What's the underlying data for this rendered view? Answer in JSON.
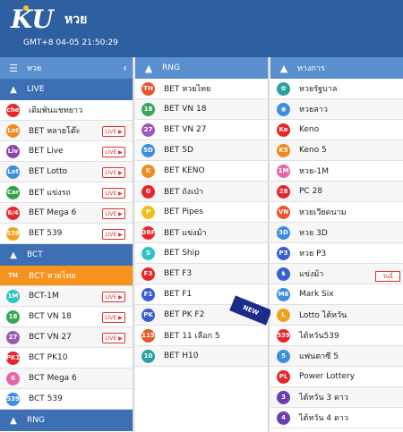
{
  "header": {
    "logo_text": "KU",
    "brand": "หวย",
    "clock": "GMT+8 04-05 21:50:29"
  },
  "left": {
    "top_label": "หวย",
    "sections": [
      {
        "title": "LIVE",
        "items": [
          {
            "label": "เดิมพันแชทยาว",
            "icon": "check",
            "color": "#e8252a",
            "live": false
          },
          {
            "label": "BET หลายโต๊ะ",
            "icon": "Lottery",
            "color": "#f08a1c",
            "live": true
          },
          {
            "label": "BET Live",
            "icon": "Live",
            "color": "#8e44ad",
            "live": true
          },
          {
            "label": "BET Lotto",
            "icon": "Lotto",
            "color": "#3a8de0",
            "live": true
          },
          {
            "label": "BET แข่งรถ",
            "icon": "Car",
            "color": "#2aa148",
            "live": true
          },
          {
            "label": "BET Mega 6",
            "icon": "6/49",
            "color": "#e8252a",
            "live": true
          },
          {
            "label": "BET 539",
            "icon": "539",
            "color": "#f0a21c",
            "live": true
          }
        ]
      },
      {
        "title": "BCT",
        "items": [
          {
            "label": "BCT หวยไทย",
            "icon": "TH",
            "color": "#f7941d",
            "live": false,
            "selected": true
          },
          {
            "label": "BCT-1M",
            "icon": "1M",
            "color": "#2ec4c4",
            "live": true
          },
          {
            "label": "BCT VN 18",
            "icon": "18",
            "color": "#3ba55c",
            "live": true
          },
          {
            "label": "BCT VN 27",
            "icon": "27",
            "color": "#9b59b6",
            "live": true
          },
          {
            "label": "BCT PK10",
            "icon": "PK10",
            "color": "#e8252a",
            "live": false
          },
          {
            "label": "BCT Mega 6",
            "icon": "6",
            "color": "#e667a8",
            "live": false
          },
          {
            "label": "BCT 539",
            "icon": "539",
            "color": "#3a8de0",
            "live": false
          }
        ]
      },
      {
        "title": "RNG",
        "items": []
      }
    ]
  },
  "middle": {
    "top_label": "RNG",
    "items": [
      {
        "label": "BET หวยไทย",
        "icon": "TH",
        "color": "#e8552a"
      },
      {
        "label": "BET VN 18",
        "icon": "18",
        "color": "#3ba55c"
      },
      {
        "label": "BET VN 27",
        "icon": "27",
        "color": "#9b59b6"
      },
      {
        "label": "BET 5D",
        "icon": "5D",
        "color": "#3a8de0"
      },
      {
        "label": "BET KENO",
        "icon": "K",
        "color": "#f08a1c"
      },
      {
        "label": "BET ถังเป่า",
        "icon": "G",
        "color": "#e8252a"
      },
      {
        "label": "BET Pipes",
        "icon": "P",
        "color": "#f0c01c"
      },
      {
        "label": "BET แข่งม้า",
        "icon": "DRF",
        "color": "#e8252a"
      },
      {
        "label": "BET Ship",
        "icon": "S",
        "color": "#2ec4c4"
      },
      {
        "label": "BET F3",
        "icon": "F3",
        "color": "#e8252a"
      },
      {
        "label": "BET F1",
        "icon": "F1",
        "color": "#3a5fd0"
      },
      {
        "label": "BET PK F2",
        "icon": "PK",
        "color": "#3a5fd0"
      },
      {
        "label": "BET 11 เลือก 5",
        "icon": "115",
        "color": "#e8552a"
      },
      {
        "label": "BET H10",
        "icon": "10",
        "color": "#2aa1a1"
      }
    ],
    "ribbon": "NEW"
  },
  "right": {
    "top_label": "ทางการ",
    "items": [
      {
        "label": "หวยรัฐบาล",
        "icon": "✿",
        "color": "#2aa1a1"
      },
      {
        "label": "หวยลาว",
        "icon": "◉",
        "color": "#3a8de0"
      },
      {
        "label": "Keno",
        "icon": "Ke",
        "color": "#e8252a"
      },
      {
        "label": "Keno 5",
        "icon": "K5",
        "color": "#f08a1c"
      },
      {
        "label": "หวย-1M",
        "icon": "1M",
        "color": "#e667a8"
      },
      {
        "label": "PC 28",
        "icon": "28",
        "color": "#e8252a"
      },
      {
        "label": "หวยเวียดนาม",
        "icon": "VN",
        "color": "#e8552a"
      },
      {
        "label": "หวย 3D",
        "icon": "3D",
        "color": "#3a8de0"
      },
      {
        "label": "หวย P3",
        "icon": "P3",
        "color": "#3a5fd0"
      },
      {
        "label": "แข่งม้า",
        "icon": "♞",
        "color": "#3a5fd0",
        "badge": "วันนี้"
      },
      {
        "label": "Mark Six",
        "icon": "M6",
        "color": "#3a8de0"
      },
      {
        "label": "Lotto ไต้หวัน",
        "icon": "L",
        "color": "#f0a21c"
      },
      {
        "label": "ไต้หวัน539",
        "icon": "539",
        "color": "#e8252a"
      },
      {
        "label": "แฟนตาซี 5",
        "icon": "5",
        "color": "#3a8de0"
      },
      {
        "label": "Power Lottery",
        "icon": "PL",
        "color": "#e8252a"
      },
      {
        "label": "ไต้หวัน 3 ดาว",
        "icon": "3",
        "color": "#6a3fb5"
      },
      {
        "label": "ไต้หวัน 4 ดาว",
        "icon": "4",
        "color": "#6a3fb5"
      }
    ]
  }
}
